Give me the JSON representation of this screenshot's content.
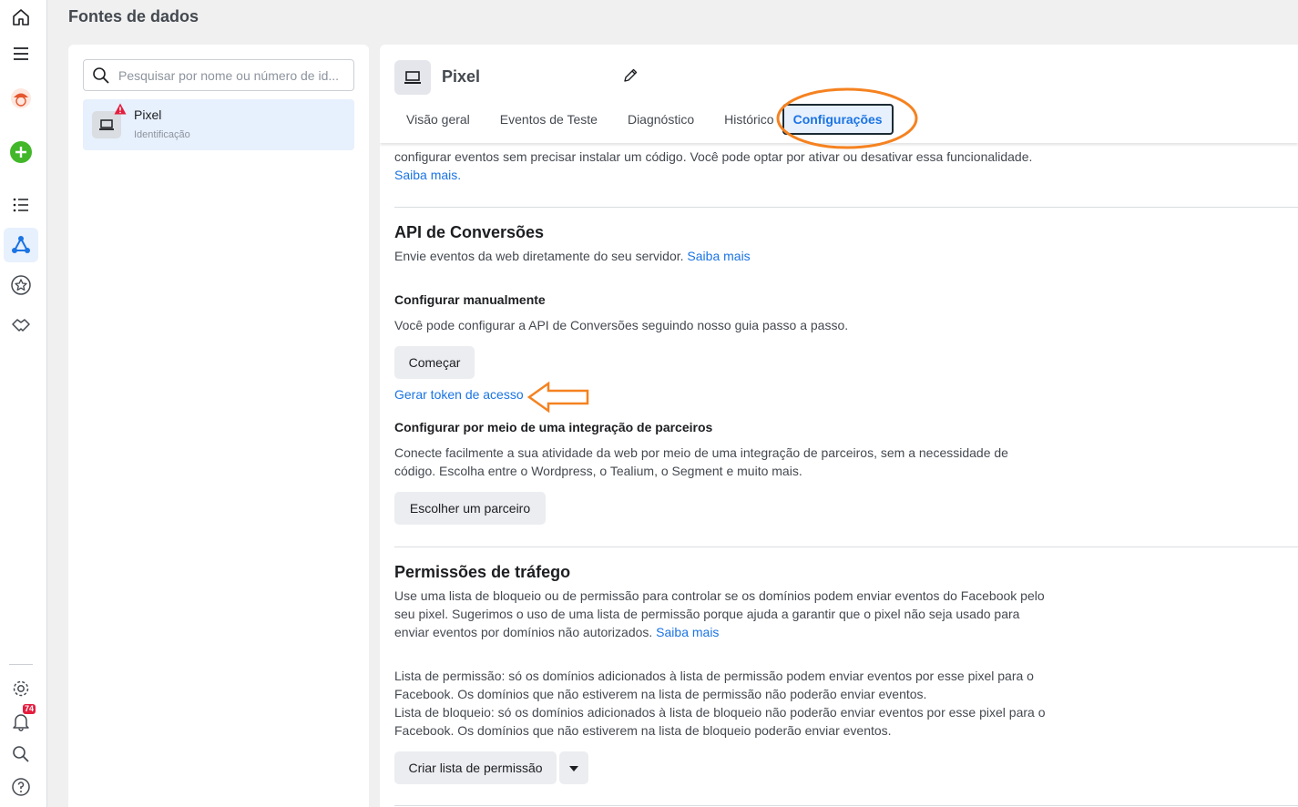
{
  "page_title": "Fontes de dados",
  "notifications_badge": "74",
  "search": {
    "placeholder": "Pesquisar por nome ou número de id..."
  },
  "source": {
    "name": "Pixel",
    "subtitle": "Identificação"
  },
  "pixel": {
    "title": "Pixel"
  },
  "tabs": [
    {
      "label": "Visão geral"
    },
    {
      "label": "Eventos de Teste"
    },
    {
      "label": "Diagnóstico"
    },
    {
      "label": "Histórico"
    },
    {
      "label": "Configurações"
    }
  ],
  "intro": {
    "line1": "configurar eventos sem precisar instalar um código. Você pode optar por ativar ou desativar essa funcionalidade.",
    "link": "Saiba mais."
  },
  "capi": {
    "title": "API de Conversões",
    "desc": "Envie eventos da web diretamente do seu servidor.",
    "link": "Saiba mais",
    "manual_title": "Configurar manualmente",
    "manual_desc": "Você pode configurar a API de Conversões seguindo nosso guia passo a passo.",
    "start_button": "Começar",
    "token_link": "Gerar token de acesso",
    "partner_title": "Configurar por meio de uma integração de parceiros",
    "partner_desc_1": "Conecte facilmente a sua atividade da web por meio de uma integração de parceiros, sem a necessidade de",
    "partner_desc_2": "código. Escolha entre o Wordpress, o Tealium, o Segment e muito mais.",
    "partner_button": "Escolher um parceiro"
  },
  "traffic": {
    "title": "Permissões de tráfego",
    "desc_1": "Use uma lista de bloqueio ou de permissão para controlar se os domínios podem enviar eventos do Facebook pelo",
    "desc_2": "seu pixel. Sugerimos o uso de uma lista de permissão porque ajuda a garantir que o pixel não seja usado para",
    "desc_3": "enviar eventos por domínios não autorizados.",
    "link": "Saiba mais",
    "allow_1": "Lista de permissão: só os domínios adicionados à lista de permissão podem enviar eventos por esse pixel para o",
    "allow_2": "Facebook. Os domínios que não estiverem na lista de permissão não poderão enviar eventos.",
    "block_1": "Lista de bloqueio: só os domínios adicionados à lista de bloqueio não poderão enviar eventos por esse pixel para o",
    "block_2": "Facebook. Os domínios que não estiverem na lista de bloqueio poderão enviar eventos.",
    "create_button": "Criar lista de permissão"
  },
  "colors": {
    "accent": "#1b74e4",
    "annotation": "#f58220",
    "alert": "#e41e3f",
    "add": "#42b72a"
  }
}
